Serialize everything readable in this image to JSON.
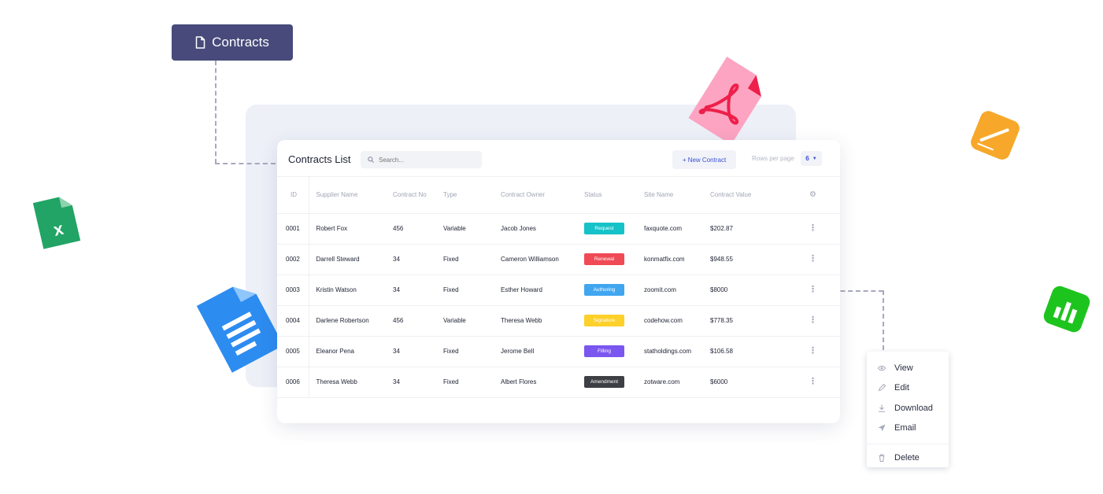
{
  "badge": {
    "label": "Contracts",
    "icon": "document-icon"
  },
  "card": {
    "title": "Contracts List",
    "search_placeholder": "Search...",
    "new_button": "+ New Contract",
    "rows_per_page_label": "Rows per page",
    "rows_per_page_value": "6"
  },
  "table": {
    "headers": [
      "ID",
      "Supplier Name",
      "Contract No",
      "Type",
      "Contract Owner",
      "Status",
      "Site Name",
      "Contract Value"
    ],
    "rows": [
      {
        "id": "0001",
        "supplier": "Robert Fox",
        "no": "456",
        "type": "Variable",
        "owner": "Jacob Jones",
        "status": "Request",
        "status_color": "#14c2c8",
        "site": "faxquote.com",
        "value": "$202.87"
      },
      {
        "id": "0002",
        "supplier": "Darrell Steward",
        "no": "34",
        "type": "Fixed",
        "owner": "Cameron Williamson",
        "status": "Renewal",
        "status_color": "#ef4a55",
        "site": "konmatfix.com",
        "value": "$948.55"
      },
      {
        "id": "0003",
        "supplier": "Kristin Watson",
        "no": "34",
        "type": "Fixed",
        "owner": "Esther Howard",
        "status": "Authoring",
        "status_color": "#41a6f0",
        "site": "zoomit.com",
        "value": "$8000"
      },
      {
        "id": "0004",
        "supplier": "Darlene Robertson",
        "no": "456",
        "type": "Variable",
        "owner": "Theresa Webb",
        "status": "Signature",
        "status_color": "#fdd02a",
        "site": "codehow.com",
        "value": "$778.35"
      },
      {
        "id": "0005",
        "supplier": "Eleanor Pena",
        "no": "34",
        "type": "Fixed",
        "owner": "Jerome Bell",
        "status": "Filling",
        "status_color": "#7b56ef",
        "site": "statholdings.com",
        "value": "$106.58"
      },
      {
        "id": "0006",
        "supplier": "Theresa Webb",
        "no": "34",
        "type": "Fixed",
        "owner": "Albert Flores",
        "status": "Amendment",
        "status_color": "#3d3f44",
        "site": "zotware.com",
        "value": "$6000"
      }
    ]
  },
  "menu": {
    "items": [
      {
        "label": "View",
        "icon": "eye-icon"
      },
      {
        "label": "Edit",
        "icon": "pencil-icon"
      },
      {
        "label": "Download",
        "icon": "download-icon"
      },
      {
        "label": "Email",
        "icon": "send-icon"
      }
    ],
    "delete": {
      "label": "Delete",
      "icon": "trash-icon"
    }
  },
  "colors": {
    "badge_bg": "#474a7a",
    "accent": "#3b4fd1"
  }
}
